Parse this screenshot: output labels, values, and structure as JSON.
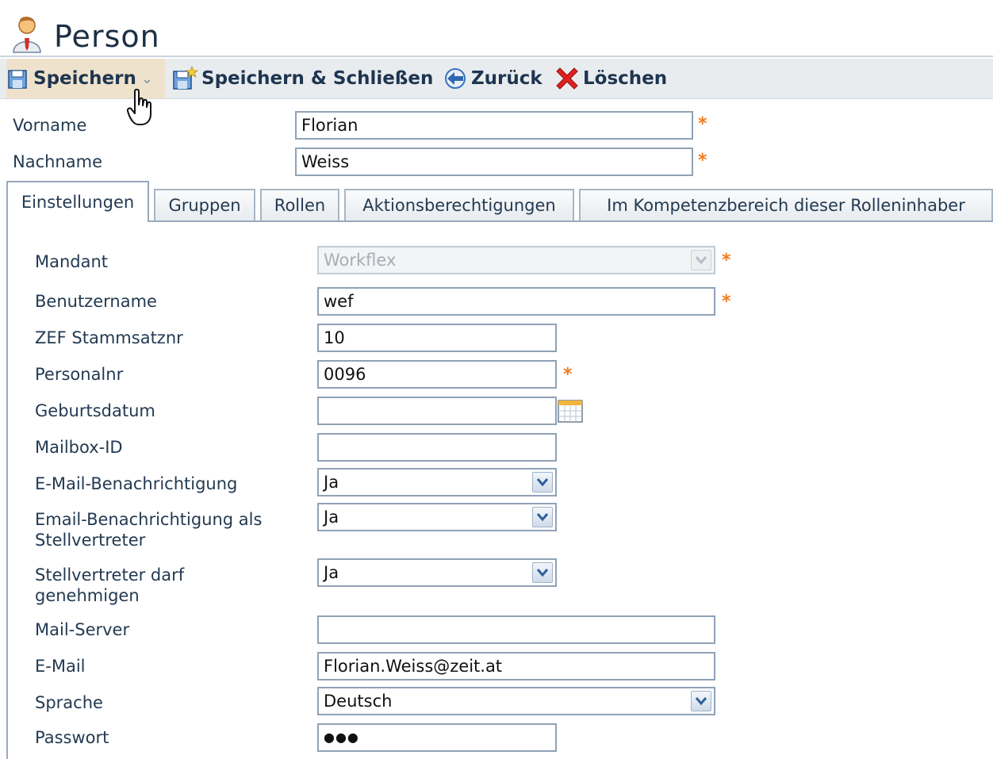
{
  "header": {
    "title": "Person",
    "icon": "person-icon"
  },
  "toolbar": {
    "save": "Speichern",
    "save_close": "Speichern & Schließen",
    "back": "Zurück",
    "delete": "Löschen"
  },
  "person": {
    "vorname_label": "Vorname",
    "vorname_value": "Florian",
    "nachname_label": "Nachname",
    "nachname_value": "Weiss"
  },
  "tabs": [
    {
      "label": "Einstellungen",
      "active": true
    },
    {
      "label": "Gruppen",
      "active": false
    },
    {
      "label": "Rollen",
      "active": false
    },
    {
      "label": "Aktionsberechtigungen",
      "active": false
    },
    {
      "label": "Im Kompetenzbereich dieser Rolleninhaber",
      "active": false
    }
  ],
  "settings": {
    "mandant_label": "Mandant",
    "mandant_value": "Workflex",
    "benutzername_label": "Benutzername",
    "benutzername_value": "wef",
    "zef_label": "ZEF Stammsatznr",
    "zef_value": "10",
    "personalnr_label": "Personalnr",
    "personalnr_value": "0096",
    "geburtsdatum_label": "Geburtsdatum",
    "geburtsdatum_value": "",
    "mailbox_label": "Mailbox-ID",
    "mailbox_value": "",
    "email_benachrichtigung_label": "E-Mail-Benachrichtigung",
    "email_benachrichtigung_value": "Ja",
    "stellvertreter_benachrichtigung_label_1": "Email-Benachrichtigung als",
    "stellvertreter_benachrichtigung_label_2": "Stellvertreter",
    "stellvertreter_benachrichtigung_value": "Ja",
    "stellvertreter_genehmigen_label_1": "Stellvertreter darf",
    "stellvertreter_genehmigen_label_2": "genehmigen",
    "stellvertreter_genehmigen_value": "Ja",
    "mailserver_label": "Mail-Server",
    "mailserver_value": "",
    "email_label": "E-Mail",
    "email_value": "Florian.Weiss@zeit.at",
    "sprache_label": "Sprache",
    "sprache_value": "Deutsch",
    "passwort_label": "Passwort",
    "passwort_value": "●●●"
  },
  "required_marker": "*",
  "colors": {
    "required": "#f07c1e",
    "toolbar_bg": "#e9ecef",
    "save_highlight": "#efe2cc",
    "delete": "#e02020"
  }
}
